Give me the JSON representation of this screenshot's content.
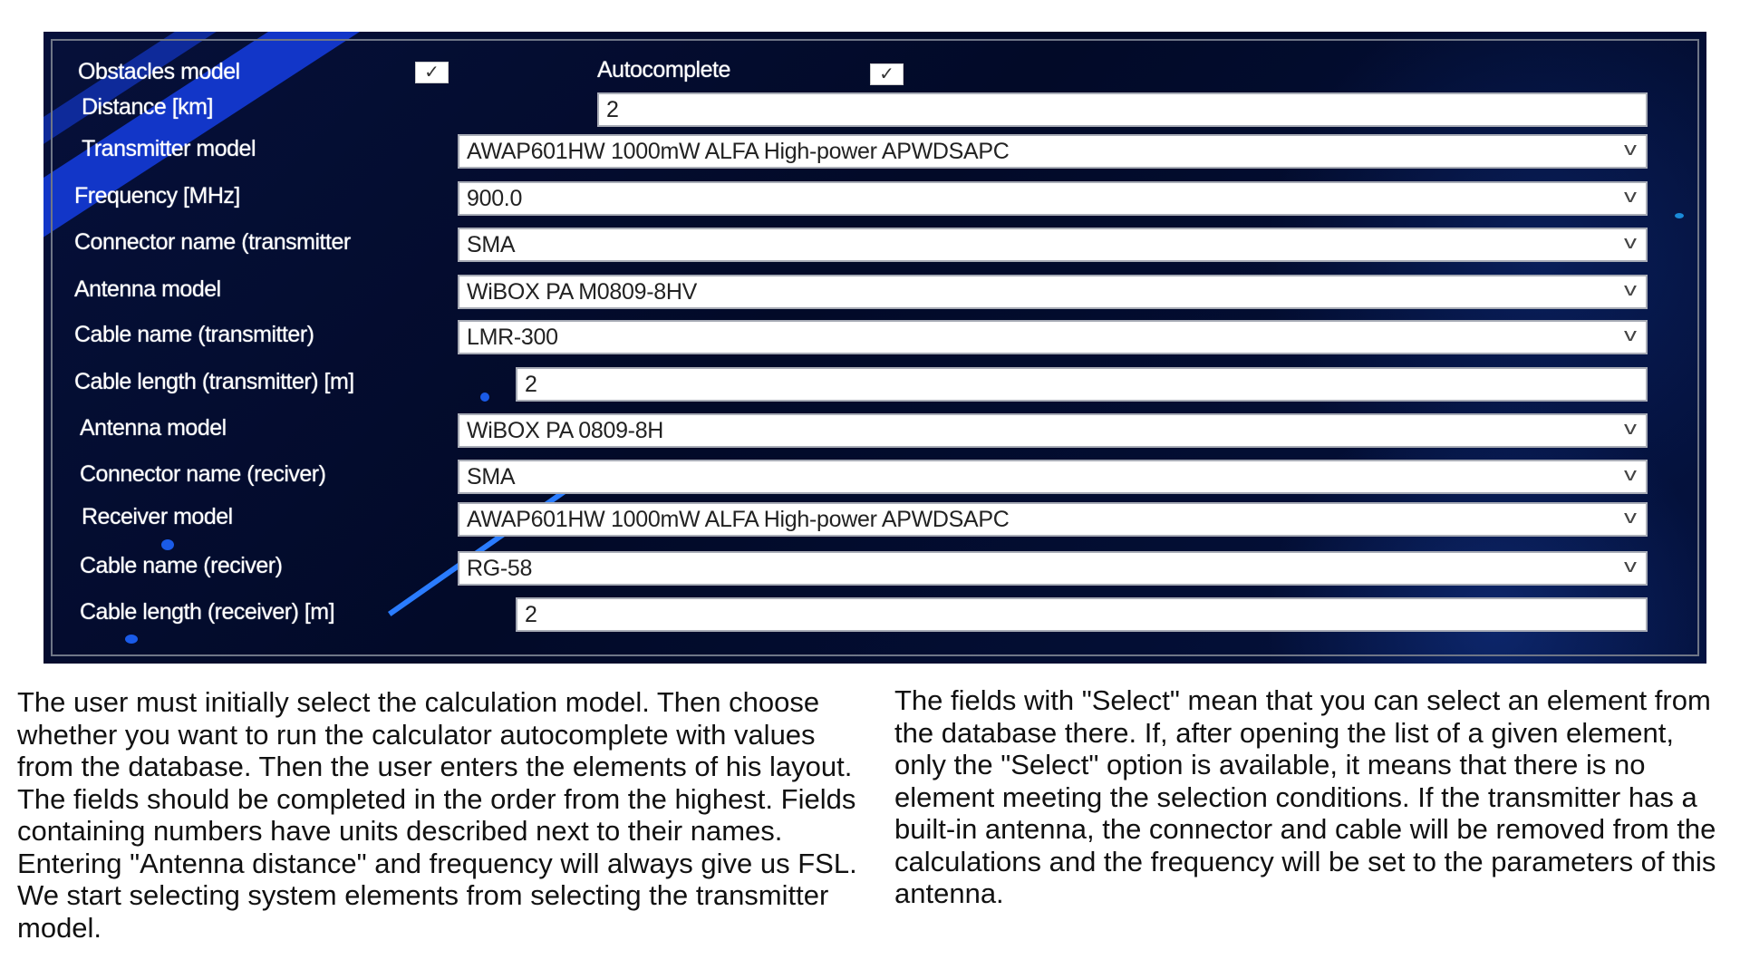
{
  "form": {
    "obstacles_label": "Obstacles model",
    "obstacles_checked": true,
    "autocomplete_label": "Autocomplete",
    "autocomplete_checked": true,
    "rows": [
      {
        "label": "Distance [km]",
        "value": "2",
        "type": "text"
      },
      {
        "label": "Transmitter model",
        "value": "AWAP601HW 1000mW ALFA High-power APWDSAPC",
        "type": "select"
      },
      {
        "label": "Frequency [MHz]",
        "value": "900.0",
        "type": "select"
      },
      {
        "label": "Connector name (transmitter",
        "value": "SMA",
        "type": "select"
      },
      {
        "label": "Antenna model",
        "value": "WiBOX PA M0809-8HV",
        "type": "select"
      },
      {
        "label": "Cable name (transmitter)",
        "value": "LMR-300",
        "type": "select"
      },
      {
        "label": "Cable length (transmitter) [m]",
        "value": "2",
        "type": "text"
      },
      {
        "label": "Antenna model",
        "value": "WiBOX PA 0809-8H",
        "type": "select"
      },
      {
        "label": "Connector name (reciver)",
        "value": "SMA",
        "type": "select"
      },
      {
        "label": "Receiver model",
        "value": "AWAP601HW 1000mW ALFA High-power APWDSAPC",
        "type": "select"
      },
      {
        "label": "Cable name (reciver)",
        "value": "RG-58",
        "type": "select"
      },
      {
        "label": "Cable length (receiver) [m]",
        "value": "2",
        "type": "text"
      }
    ],
    "check_glyph": "✓",
    "chevron_glyph": "v"
  },
  "description": {
    "left": "The user must initially select the calculation model. Then choose whether you want to run the calculator autocomplete with values from the database. Then the user enters the elements of his layout. The fields should be completed in the order from the highest. Fields containing numbers have units described next to their names. Entering \"Antenna distance\" and frequency will always give us FSL. We start selecting system elements from selecting the transmitter model.",
    "right": "The fields with \"Select\" mean that you can select an element from the database there. If, after opening the list of a given element, only the \"Select\" option is available, it means that there is no element meeting the selection conditions. If the transmitter has a built-in antenna, the connector and cable will be removed from the calculations and the frequency will be set to the parameters of this antenna."
  }
}
